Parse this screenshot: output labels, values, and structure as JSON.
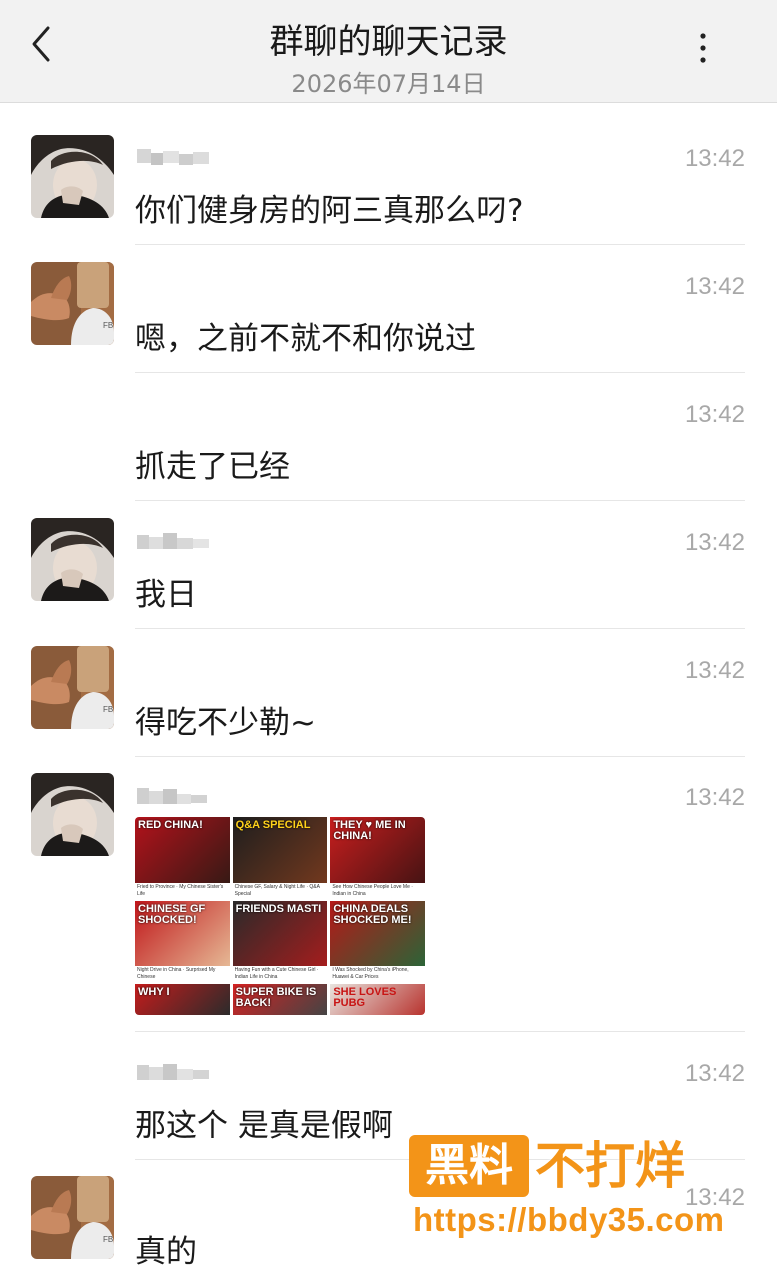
{
  "header": {
    "title": "群聊的聊天记录",
    "date": "2026年07月14日",
    "back_icon": "chevron-left-icon",
    "more_icon": "more-vertical-icon"
  },
  "messages": [
    {
      "sender": "user-a",
      "text": "你们健身房的阿三真那么叼?",
      "time": "13:42"
    },
    {
      "sender": "user-b",
      "text": "嗯，之前不就不和你说过",
      "time": "13:42"
    },
    {
      "sender": "user-b",
      "text": "抓走了已经",
      "time": "13:42"
    },
    {
      "sender": "user-a",
      "text": "我日",
      "time": "13:42"
    },
    {
      "sender": "user-b",
      "text": "得吃不少勒~",
      "time": "13:42"
    },
    {
      "sender": "user-a",
      "text": "",
      "time": "13:42",
      "image": {
        "tiles": [
          {
            "title": "RED CHINA!",
            "caption": "Fried to Province · My Chinese Sister's Life"
          },
          {
            "title": "Q&A SPECIAL",
            "caption": "Chinese GF, Salary & Night Life · Q&A Special"
          },
          {
            "title": "THEY ♥ ME IN CHINA!",
            "caption": "See How Chinese People Love Me · Indian in China"
          },
          {
            "title": "CHINESE GF SHOCKED!",
            "caption": "Night Drive in China · Surprised My Chinese"
          },
          {
            "title": "FRIENDS MASTI",
            "caption": "Having Fun with a Cute Chinese Girl · Indian Life in China"
          },
          {
            "title": "CHINA DEALS SHOCKED ME!",
            "caption": "I Was Shocked by China's iPhone, Huawei & Car Prices"
          },
          {
            "title": "WHY I",
            "caption": ""
          },
          {
            "title": "SUPER BIKE IS BACK!",
            "caption": ""
          },
          {
            "title": "SHE LOVES PUBG",
            "caption": ""
          }
        ]
      }
    },
    {
      "sender": "user-a",
      "text": "那这个 是真是假啊",
      "time": "13:42"
    },
    {
      "sender": "user-b",
      "text": "真的",
      "time": "13:42"
    }
  ],
  "watermark": {
    "box_text": "黑料",
    "text": "不打烊",
    "url": "https://bbdy35.com"
  },
  "colors": {
    "header_bg": "#f2f2f2",
    "time": "#a8a8a8",
    "watermark": "#f39418"
  }
}
